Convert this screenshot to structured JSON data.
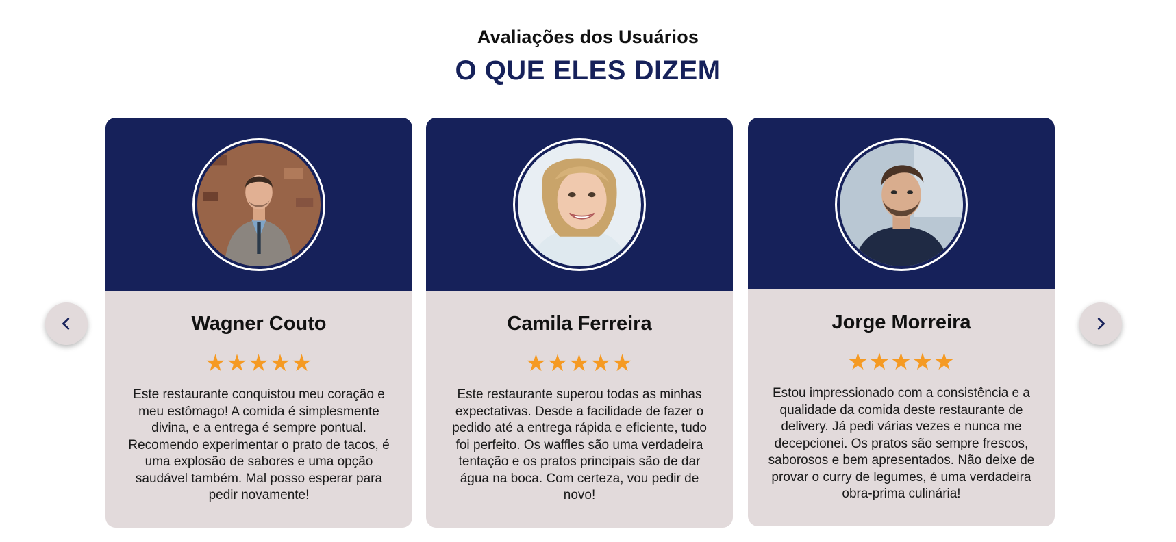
{
  "header": {
    "subtitle": "Avaliações dos Usuários",
    "title": "O QUE ELES DIZEM"
  },
  "navigation": {
    "prev_icon": "chevron-left-icon",
    "next_icon": "chevron-right-icon"
  },
  "colors": {
    "primary": "#16215a",
    "card_background": "#e2dadb",
    "star": "#f59a23"
  },
  "testimonials": [
    {
      "name": "Wagner Couto",
      "rating": 5,
      "stars": "★★★★★",
      "review": "Este restaurante conquistou meu coração e meu estômago! A comida é simplesmente divina, e a entrega é sempre pontual. Recomendo experimentar o prato de tacos, é uma explosão de sabores e uma opção saudável também. Mal posso esperar para pedir novamente!"
    },
    {
      "name": "Camila Ferreira",
      "rating": 5,
      "stars": "★★★★★",
      "review": "Este restaurante superou todas as minhas expectativas. Desde a facilidade de fazer o pedido até a entrega rápida e eficiente, tudo foi perfeito. Os waffles são uma verdadeira tentação e os pratos principais são de dar água na boca. Com certeza, vou pedir de novo!"
    },
    {
      "name": "Jorge Morreira",
      "rating": 5,
      "stars": "★★★★★",
      "review": "Estou impressionado com a consistência e a qualidade da comida deste restaurante de delivery. Já pedi várias vezes e nunca me decepcionei. Os pratos são sempre frescos, saborosos e bem apresentados. Não deixe de provar o curry de legumes, é uma verdadeira obra-prima culinária!"
    }
  ]
}
